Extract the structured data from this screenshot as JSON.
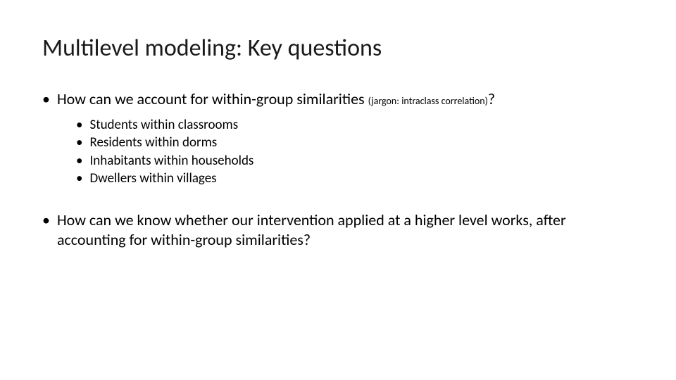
{
  "title": "Multilevel modeling: Key questions",
  "bullets": {
    "b1_pre": "How can we account for within-group similarities ",
    "b1_jargon": "(jargon: intraclass correlation)",
    "b1_post": "?",
    "sub": [
      "Students within classrooms",
      "Residents within dorms",
      "Inhabitants within households",
      "Dwellers within villages"
    ],
    "b2": "How can we know whether our intervention applied at a higher level works, after accounting for within-group similarities?"
  },
  "dot": "•"
}
